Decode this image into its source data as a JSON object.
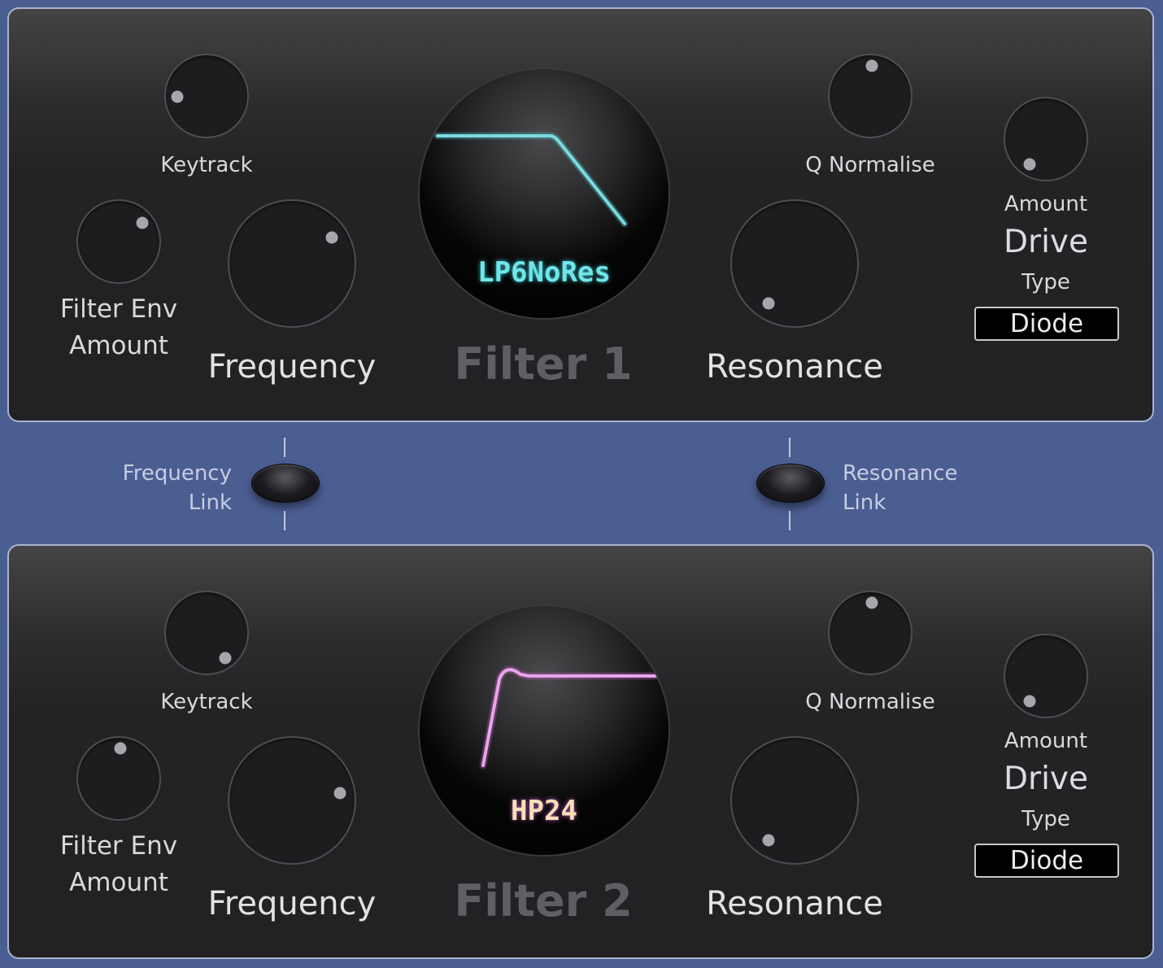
{
  "filters": [
    {
      "title": "Filter 1",
      "mode": "LP6NoRes",
      "mode_color": "#6fe6e8",
      "curve_color": "#7fd9dc",
      "curve_glow": "#3fb7c0",
      "labels": {
        "keytrack": "Keytrack",
        "q_normalise": "Q Normalise",
        "filter_env": "Filter Env",
        "filter_env_amount": "Amount",
        "frequency": "Frequency",
        "resonance": "Resonance",
        "drive_amount": "Amount",
        "drive": "Drive",
        "drive_type": "Type"
      },
      "drive_type_value": "Diode"
    },
    {
      "title": "Filter 2",
      "mode": "HP24",
      "mode_color": "#f7dfb8",
      "curve_color": "#e6a6e8",
      "curve_glow": "#b75ab9",
      "labels": {
        "keytrack": "Keytrack",
        "q_normalise": "Q Normalise",
        "filter_env": "Filter Env",
        "filter_env_amount": "Amount",
        "frequency": "Frequency",
        "resonance": "Resonance",
        "drive_amount": "Amount",
        "drive": "Drive",
        "drive_type": "Type"
      },
      "drive_type_value": "Diode"
    }
  ],
  "links": {
    "frequency_link": [
      "Frequency",
      "Link"
    ],
    "resonance_link": [
      "Resonance",
      "Link"
    ]
  }
}
